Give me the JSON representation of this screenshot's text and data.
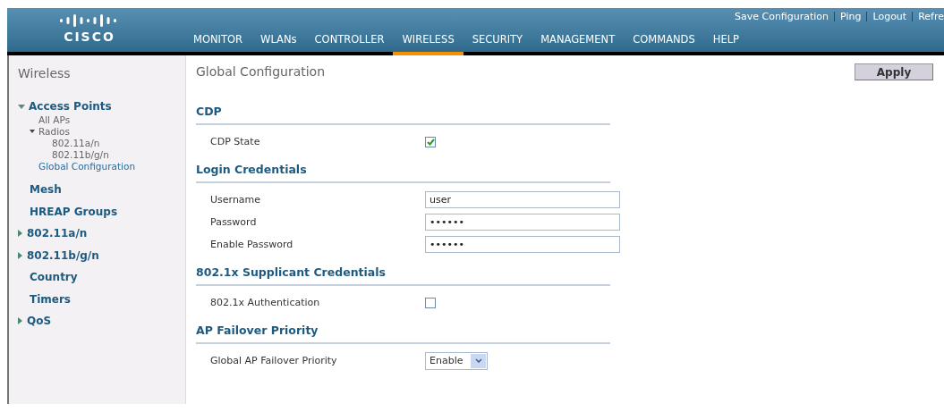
{
  "header": {
    "logo": "CISCO",
    "top_links": [
      "Save Configuration",
      "Ping",
      "Logout",
      "Refre"
    ],
    "nav": [
      {
        "label": "MONITOR",
        "selected": false
      },
      {
        "label": "WLANs",
        "selected": false
      },
      {
        "label": "CONTROLLER",
        "selected": false
      },
      {
        "label": "WIRELESS",
        "selected": true
      },
      {
        "label": "SECURITY",
        "selected": false
      },
      {
        "label": "MANAGEMENT",
        "selected": false
      },
      {
        "label": "COMMANDS",
        "selected": false
      },
      {
        "label": "HELP",
        "selected": false
      }
    ]
  },
  "sidebar": {
    "title": "Wireless",
    "items": [
      {
        "label": "Access Points",
        "expanded": true,
        "children": [
          {
            "label": "All APs"
          },
          {
            "label": "Radios",
            "expanded": true,
            "children": [
              {
                "label": "802.11a/n"
              },
              {
                "label": "802.11b/g/n"
              }
            ]
          },
          {
            "label": "Global Configuration",
            "selected": true
          }
        ]
      },
      {
        "label": "Mesh"
      },
      {
        "label": "HREAP Groups"
      },
      {
        "label": "802.11a/n",
        "expanded": false
      },
      {
        "label": "802.11b/g/n",
        "expanded": false
      },
      {
        "label": "Country"
      },
      {
        "label": "Timers"
      },
      {
        "label": "QoS",
        "expanded": false
      }
    ]
  },
  "page": {
    "title": "Global Configuration",
    "apply_button": "Apply",
    "sections": [
      {
        "heading": "CDP",
        "fields": [
          {
            "kind": "checkbox",
            "label": "CDP State",
            "checked": true
          }
        ]
      },
      {
        "heading": "Login Credentials",
        "fields": [
          {
            "kind": "text",
            "label": "Username",
            "value": "user"
          },
          {
            "kind": "text",
            "label": "Password",
            "value": "••••••"
          },
          {
            "kind": "text",
            "label": "Enable Password",
            "value": "••••••"
          }
        ]
      },
      {
        "heading": "802.1x Supplicant Credentials",
        "fields": [
          {
            "kind": "checkbox",
            "label": "802.1x Authentication",
            "checked": false
          }
        ]
      },
      {
        "heading": "AP Failover Priority",
        "fields": [
          {
            "kind": "select",
            "label": "Global AP Failover Priority",
            "value": "Enable"
          }
        ]
      }
    ]
  }
}
